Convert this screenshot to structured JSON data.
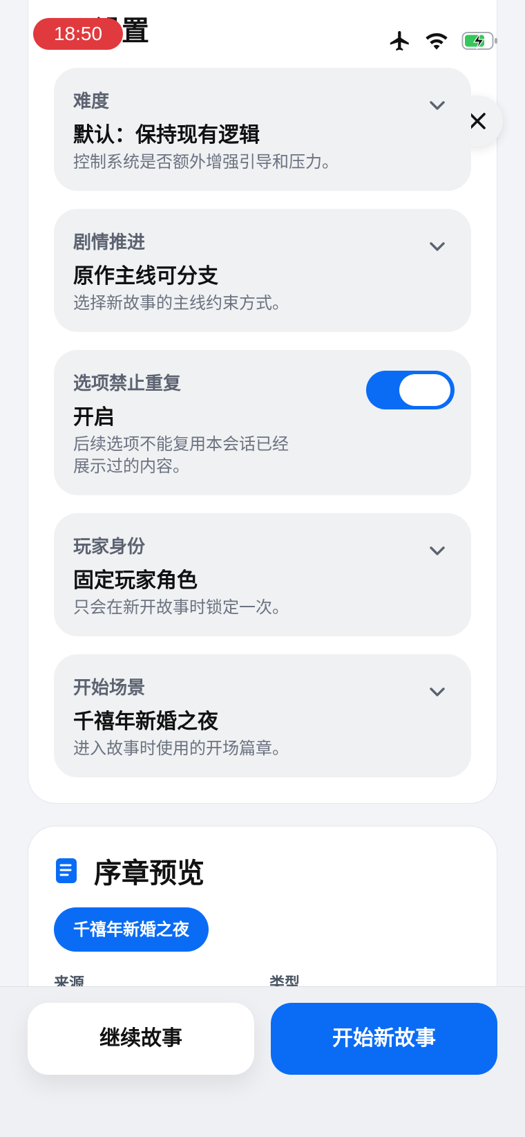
{
  "status_bar": {
    "time": "18:50",
    "icons": [
      "airplane-icon",
      "wifi-icon",
      "battery-charging-icon"
    ],
    "battery_color": "#34c759"
  },
  "settings": {
    "section_title": "设置",
    "items": [
      {
        "label": "难度",
        "value": "默认：保持现有逻辑",
        "desc": "控制系统是否额外增强引导和压力。"
      },
      {
        "label": "剧情推进",
        "value": "原作主线可分支",
        "desc": "选择新故事的主线约束方式。"
      },
      {
        "label": "选项禁止重复",
        "value": "开启",
        "desc_line1": "后续选项不能复用本会话已经",
        "desc_line2": "展示过的内容。",
        "toggle_on": true
      },
      {
        "label": "玩家身份",
        "value": "固定玩家角色",
        "desc": "只会在新开故事时锁定一次。"
      },
      {
        "label": "开始场景",
        "value": "千禧年新婚之夜",
        "desc": "进入故事时使用的开场篇章。"
      }
    ]
  },
  "preview": {
    "title": "序章预览",
    "chip": "千禧年新婚之夜",
    "field_source": "来源",
    "field_type": "类型"
  },
  "actions": {
    "continue": "继续故事",
    "new_story": "开始新故事"
  },
  "colors": {
    "accent": "#0a6cf5",
    "time_pill": "#e03a3e"
  }
}
